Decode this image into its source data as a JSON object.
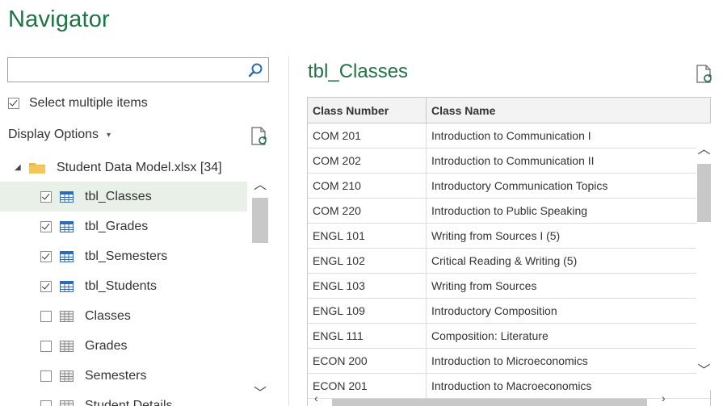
{
  "title": "Navigator",
  "search": {
    "value": "",
    "placeholder": ""
  },
  "select_multiple": {
    "label": "Select multiple items",
    "checked": true
  },
  "display_options": {
    "label": "Display Options",
    "caret": "▾"
  },
  "tree": {
    "root": {
      "label": "Student Data Model.xlsx [34]",
      "expanded": true
    },
    "items": [
      {
        "label": "tbl_Classes",
        "checked": true,
        "type": "table",
        "selected": true
      },
      {
        "label": "tbl_Grades",
        "checked": true,
        "type": "table",
        "selected": false
      },
      {
        "label": "tbl_Semesters",
        "checked": true,
        "type": "table",
        "selected": false
      },
      {
        "label": "tbl_Students",
        "checked": true,
        "type": "table",
        "selected": false
      },
      {
        "label": "Classes",
        "checked": false,
        "type": "sheet",
        "selected": false
      },
      {
        "label": "Grades",
        "checked": false,
        "type": "sheet",
        "selected": false
      },
      {
        "label": "Semesters",
        "checked": false,
        "type": "sheet",
        "selected": false
      },
      {
        "label": "Student Details",
        "checked": false,
        "type": "sheet",
        "selected": false
      }
    ]
  },
  "preview": {
    "title": "tbl_Classes",
    "columns": [
      "Class Number",
      "Class Name"
    ],
    "rows": [
      [
        "COM 201",
        "Introduction to Communication I"
      ],
      [
        "COM 202",
        "Introduction to Communication II"
      ],
      [
        "COM 210",
        "Introductory Communication Topics"
      ],
      [
        "COM 220",
        "Introduction to Public Speaking"
      ],
      [
        "ENGL 101",
        "Writing from Sources I (5)"
      ],
      [
        "ENGL 102",
        "Critical Reading & Writing (5)"
      ],
      [
        "ENGL 103",
        "Writing from Sources"
      ],
      [
        "ENGL 109",
        "Introductory Composition"
      ],
      [
        "ENGL 111",
        "Composition: Literature"
      ],
      [
        "ECON 200",
        "Introduction to Microeconomics"
      ],
      [
        "ECON 201",
        "Introduction to Macroeconomics"
      ]
    ]
  },
  "icons": {
    "search": "search-icon",
    "refresh": "refresh-document-icon",
    "table": "table-icon",
    "sheet": "sheet-icon",
    "folder": "folder-icon"
  },
  "colors": {
    "accent": "#217346",
    "selected_row": "#e8f0e8",
    "folder": "#e8b84a",
    "table_icon": "#2e6bb5"
  }
}
